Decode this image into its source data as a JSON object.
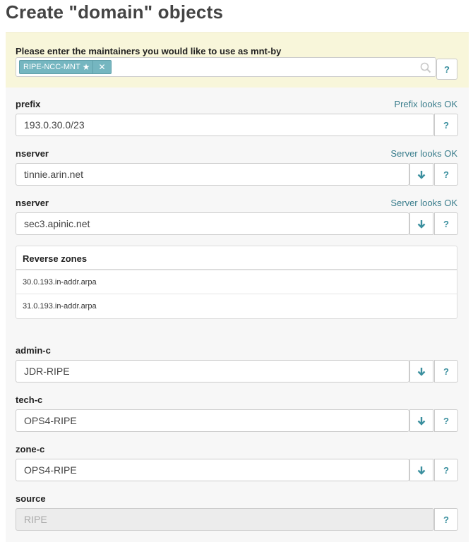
{
  "page": {
    "title": "Create \"domain\" objects"
  },
  "maintainers": {
    "label": "Please enter the maintainers you would like to use as mnt-by",
    "tags": [
      {
        "label": "RIPE-NCC-MNT",
        "icon": "star-icon"
      }
    ],
    "remove_symbol": "✕",
    "help": "?"
  },
  "fields": {
    "prefix": {
      "label": "prefix",
      "status": "Prefix looks OK",
      "value": "193.0.30.0/23",
      "help": "?"
    },
    "nserver1": {
      "label": "nserver",
      "status": "Server looks OK",
      "value": "tinnie.arin.net",
      "help": "?"
    },
    "nserver2": {
      "label": "nserver",
      "status": "Server looks OK",
      "value": "sec3.apinic.net",
      "help": "?"
    },
    "admin_c": {
      "label": "admin-c",
      "value": "JDR-RIPE",
      "help": "?"
    },
    "tech_c": {
      "label": "tech-c",
      "value": "OPS4-RIPE",
      "help": "?"
    },
    "zone_c": {
      "label": "zone-c",
      "value": "OPS4-RIPE",
      "help": "?"
    },
    "source": {
      "label": "source",
      "value": "RIPE",
      "help": "?"
    }
  },
  "reverse_zones": {
    "header": "Reverse zones",
    "rows": [
      "30.0.193.in-addr.arpa",
      "31.0.193.in-addr.arpa"
    ]
  },
  "colors": {
    "accent": "#3a8f9e",
    "tag": "#75b6c0",
    "mnt_bg": "#f8f6da"
  }
}
